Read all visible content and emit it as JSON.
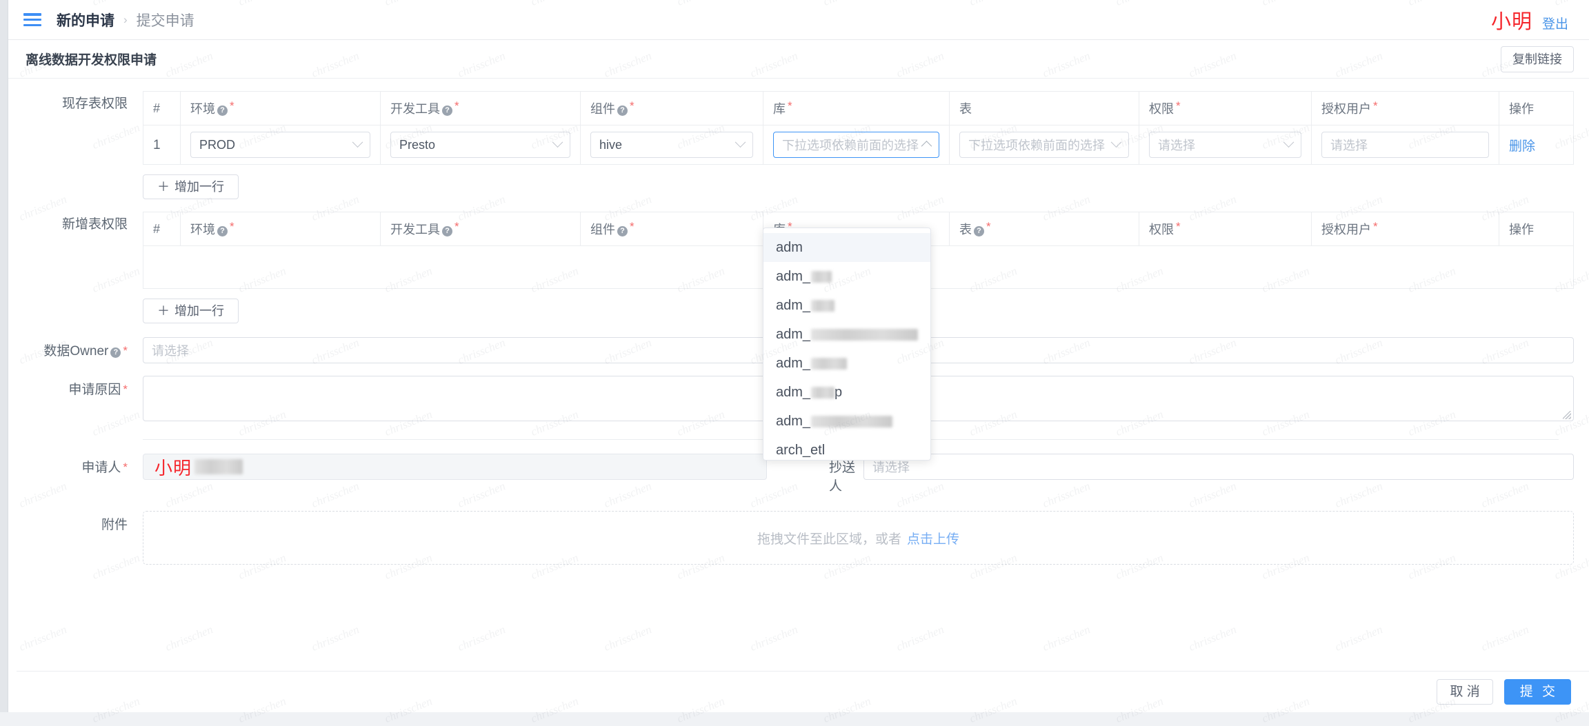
{
  "topbar": {
    "menu_icon": "hamburger-icon",
    "breadcrumb_current": "新的申请",
    "breadcrumb_sep": "›",
    "breadcrumb_sub": "提交申请",
    "user_name": "小明",
    "logout": "登出"
  },
  "card": {
    "title": "离线数据开发权限申请",
    "copy_link": "复制链接"
  },
  "sections": {
    "existing": {
      "label": "现存表权限",
      "columns": [
        "#",
        "环境",
        "开发工具",
        "组件",
        "库",
        "表",
        "权限",
        "授权用户",
        "操作"
      ],
      "col_help": [
        false,
        true,
        true,
        true,
        false,
        false,
        false,
        false,
        false
      ],
      "col_required": [
        false,
        true,
        true,
        true,
        true,
        false,
        true,
        true,
        false
      ],
      "rows": [
        {
          "index": "1",
          "env": "PROD",
          "tool": "Presto",
          "component": "hive",
          "db_placeholder": "下拉选项依赖前面的选择",
          "table_placeholder": "下拉选项依赖前面的选择",
          "perm_placeholder": "请选择",
          "user_placeholder": "请选择",
          "action": "删除"
        }
      ],
      "add_row": "增加一行"
    },
    "new": {
      "label": "新增表权限",
      "columns": [
        "#",
        "环境",
        "开发工具",
        "组件",
        "库",
        "表",
        "权限",
        "授权用户",
        "操作"
      ],
      "col_help": [
        false,
        true,
        true,
        true,
        false,
        true,
        false,
        false,
        false
      ],
      "col_required": [
        false,
        true,
        true,
        true,
        true,
        true,
        true,
        true,
        false
      ],
      "rows": [],
      "add_row": "增加一行"
    }
  },
  "dropdown": {
    "open_for": "库",
    "items": [
      {
        "text": "adm",
        "redact": 0,
        "selected": true
      },
      {
        "text": "adm_",
        "redact": 30
      },
      {
        "text": "adm_",
        "redact": 34
      },
      {
        "text": "adm_",
        "redact": 160
      },
      {
        "text": "adm_",
        "redact": 52
      },
      {
        "text": "adm_",
        "redact": 34,
        "suffix": "p"
      },
      {
        "text": "adm_",
        "redact": 118
      },
      {
        "text": "arch_etl",
        "redact": 0,
        "clipped": true
      }
    ]
  },
  "fields": {
    "owner": {
      "label": "数据Owner",
      "help": true,
      "required": true,
      "placeholder": "请选择",
      "value": ""
    },
    "reason": {
      "label": "申请原因",
      "required": true,
      "value": ""
    },
    "applicant": {
      "label": "申请人",
      "required": true,
      "value": "小明"
    },
    "cc": {
      "label": "抄送人",
      "required": false,
      "placeholder": "请选择",
      "value": ""
    },
    "attachment": {
      "label": "附件",
      "hint": "拖拽文件至此区域，或者",
      "hint_link": "点击上传"
    }
  },
  "footer": {
    "cancel": "取 消",
    "submit": "提 交"
  },
  "colors": {
    "primary": "#3d94f6",
    "link": "#4a95e8",
    "danger": "#f5262c",
    "required": "#f56c6c"
  },
  "watermark_text": "chrisschen"
}
